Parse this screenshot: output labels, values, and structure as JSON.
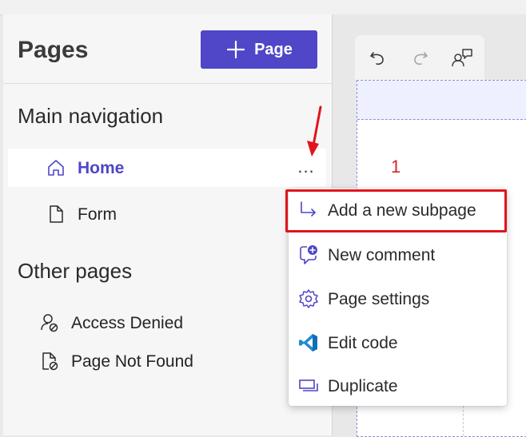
{
  "left_panel": {
    "title": "Pages",
    "add_button_label": "Page",
    "main_nav_title": "Main navigation",
    "main_nav_items": [
      {
        "label": "Home",
        "icon": "home-icon",
        "selected": true
      },
      {
        "label": "Form",
        "icon": "document-icon",
        "selected": false
      }
    ],
    "more_label": "...",
    "other_pages_title": "Other pages",
    "other_pages": [
      {
        "label": "Access Denied",
        "icon": "person-blocked-icon"
      },
      {
        "label": "Page Not Found",
        "icon": "document-blocked-icon"
      }
    ]
  },
  "toolbar": {
    "buttons": [
      "undo-icon",
      "redo-icon",
      "people-comment-icon"
    ]
  },
  "annotation": {
    "step_number": "1",
    "colors": {
      "annotation_red": "#e0141b",
      "accent": "#4f46c8"
    }
  },
  "context_menu": {
    "items": [
      {
        "label": "Add a new subpage",
        "icon": "subpage-arrow-icon"
      },
      {
        "label": "New comment",
        "icon": "comment-add-icon"
      },
      {
        "label": "Page settings",
        "icon": "settings-gear-icon"
      },
      {
        "label": "Edit code",
        "icon": "vscode-icon"
      },
      {
        "label": "Duplicate",
        "icon": "duplicate-icon"
      }
    ]
  }
}
